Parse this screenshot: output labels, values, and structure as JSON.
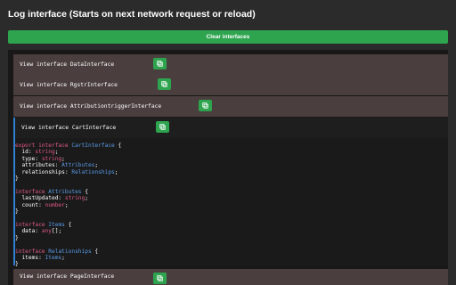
{
  "page_title": "Log interface (Starts on next network request or reload)",
  "clear_button": "Clear interfaces",
  "interfaces": [
    {
      "label": "View interface DataInterface"
    },
    {
      "label": "View interface RgstrInterface"
    },
    {
      "label": "View interface AttributiontriggerInterface"
    },
    {
      "label": "View interface CartInterface"
    },
    {
      "label": "View interface PageInterface"
    }
  ],
  "code": {
    "export_kw": "export interface",
    "interface_kw": "interface",
    "cart_name": "CartInterface",
    "attributes_name": "Attributes",
    "items_name": "Items",
    "relationships_name": "Relationships",
    "open_brace": " {",
    "close_brace": "}",
    "id_field": "  id: ",
    "type_field": "  type: ",
    "attributes_field": "  attributes: ",
    "relationships_field": "  relationships: ",
    "last_updated_field": "  lastUpdated: ",
    "count_field": "  count: ",
    "data_field": "  data: ",
    "items_field": "  items: ",
    "string_type": "string",
    "number_type": "number",
    "any_array_type": "any",
    "array_suffix": "[];",
    "semicolon": ";"
  },
  "colors": {
    "accent_green": "#2ea44f",
    "keyword": "#e05a84",
    "type": "#5a9be8",
    "row_bg": "#4a3e3e",
    "selected_border": "#2f7fd3"
  },
  "icons": {
    "copy": "copy-icon"
  }
}
